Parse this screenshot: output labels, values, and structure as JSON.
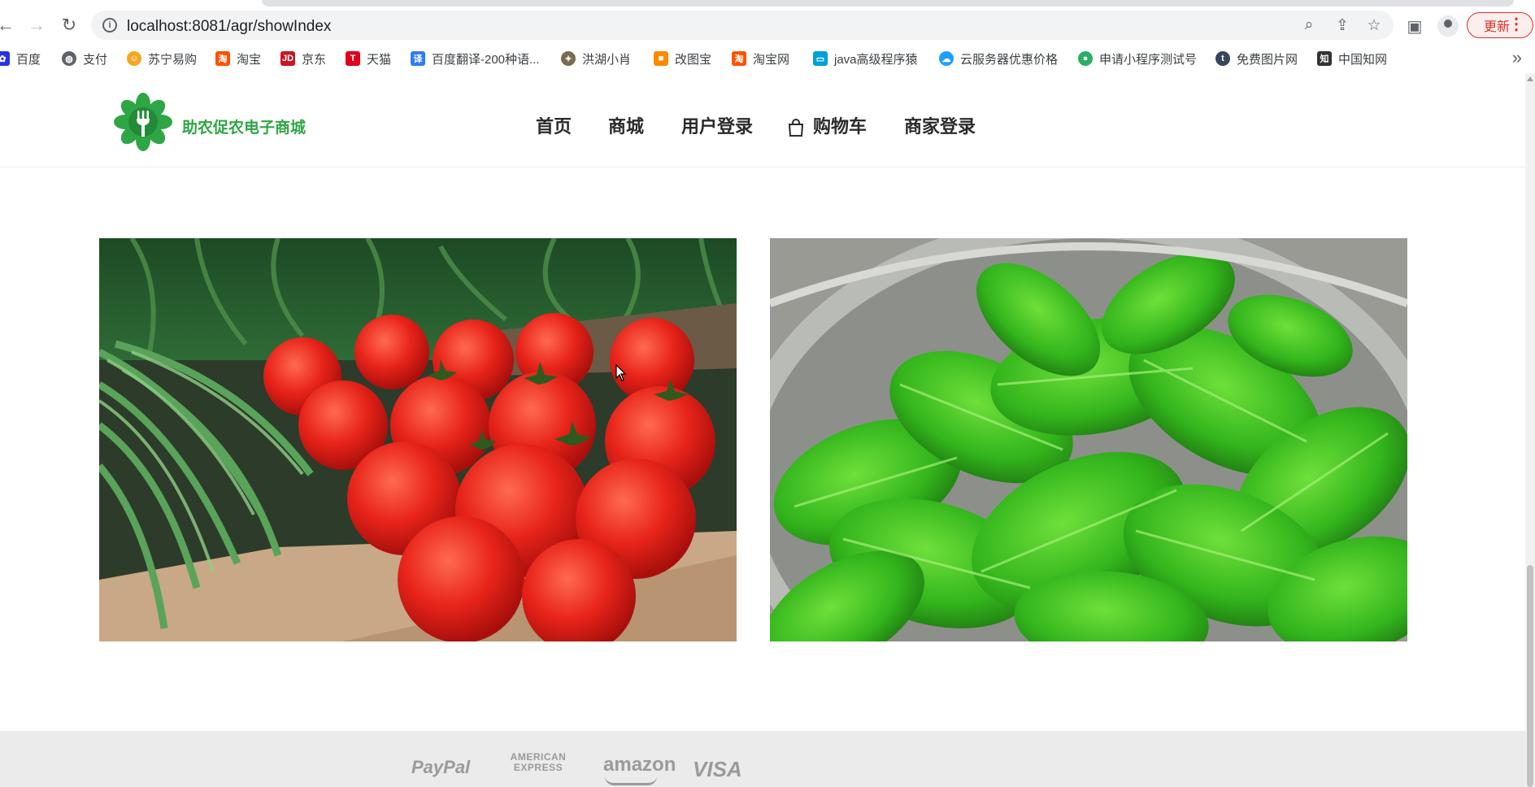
{
  "browser": {
    "url": "localhost:8081/agr/showIndex",
    "update_label": "更新",
    "bookmarks": [
      {
        "label": "百度",
        "icon": "baidu-icon",
        "color": "#2932e1"
      },
      {
        "label": "支付",
        "icon": "globe-icon",
        "color": "#5f6368"
      },
      {
        "label": "苏宁易购",
        "icon": "suning-icon",
        "color": "#f5a623"
      },
      {
        "label": "淘宝",
        "icon": "taobao-icon",
        "color": "#ff5000"
      },
      {
        "label": "京东",
        "icon": "jd-icon",
        "color": "#c91623"
      },
      {
        "label": "天猫",
        "icon": "tmall-icon",
        "color": "#e0001b"
      },
      {
        "label": "百度翻译-200种语...",
        "icon": "translate-icon",
        "color": "#2f7cf6"
      },
      {
        "label": "洪湖小肖",
        "icon": "bird-icon",
        "color": "#7a6a4f"
      },
      {
        "label": "改图宝",
        "icon": "gaitubao-icon",
        "color": "#ff8a00"
      },
      {
        "label": "淘宝网",
        "icon": "taobao-icon",
        "color": "#ff5000"
      },
      {
        "label": "java高级程序猿",
        "icon": "bilibili-icon",
        "color": "#00a1d6"
      },
      {
        "label": "云服务器优惠价格",
        "icon": "cloud-icon",
        "color": "#1e9fff"
      },
      {
        "label": "申请小程序测试号",
        "icon": "wechat-icon",
        "color": "#2aae67"
      },
      {
        "label": "免费图片网",
        "icon": "tumblr-icon",
        "color": "#36465d"
      },
      {
        "label": "中国知网",
        "icon": "cnki-icon",
        "color": "#333333"
      }
    ]
  },
  "site": {
    "brand": "助农促农电子商城",
    "brand_color": "#2fa645",
    "nav": [
      {
        "label": "首页"
      },
      {
        "label": "商城"
      },
      {
        "label": "用户登录"
      },
      {
        "label": "购物车",
        "icon": "shopping-bag-icon"
      },
      {
        "label": "商家登录"
      }
    ],
    "images": [
      {
        "subject": "tomatoes-in-crate"
      },
      {
        "subject": "spinach-in-colander"
      }
    ],
    "payment_logos": [
      "PayPal",
      "AMERICAN EXPRESS",
      "amazon",
      "VISA"
    ]
  }
}
